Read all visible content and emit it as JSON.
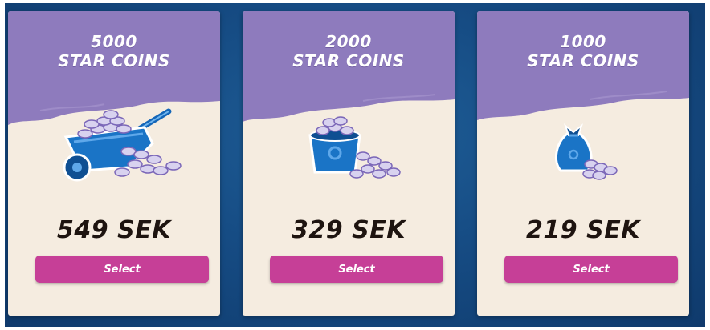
{
  "products": [
    {
      "amount": "5000",
      "unit": "STAR COINS",
      "price": "549 SEK",
      "button": "Select",
      "illustration": "wheelbarrow-coins-icon"
    },
    {
      "amount": "2000",
      "unit": "STAR COINS",
      "price": "329 SEK",
      "button": "Select",
      "illustration": "bucket-coins-icon"
    },
    {
      "amount": "1000",
      "unit": "STAR COINS",
      "price": "219 SEK",
      "button": "Select",
      "illustration": "bag-coins-icon"
    }
  ],
  "colors": {
    "header": "#8e7bbd",
    "card": "#f5ece0",
    "button": "#c63f97",
    "price": "#1e1410",
    "background": "#164c84"
  }
}
